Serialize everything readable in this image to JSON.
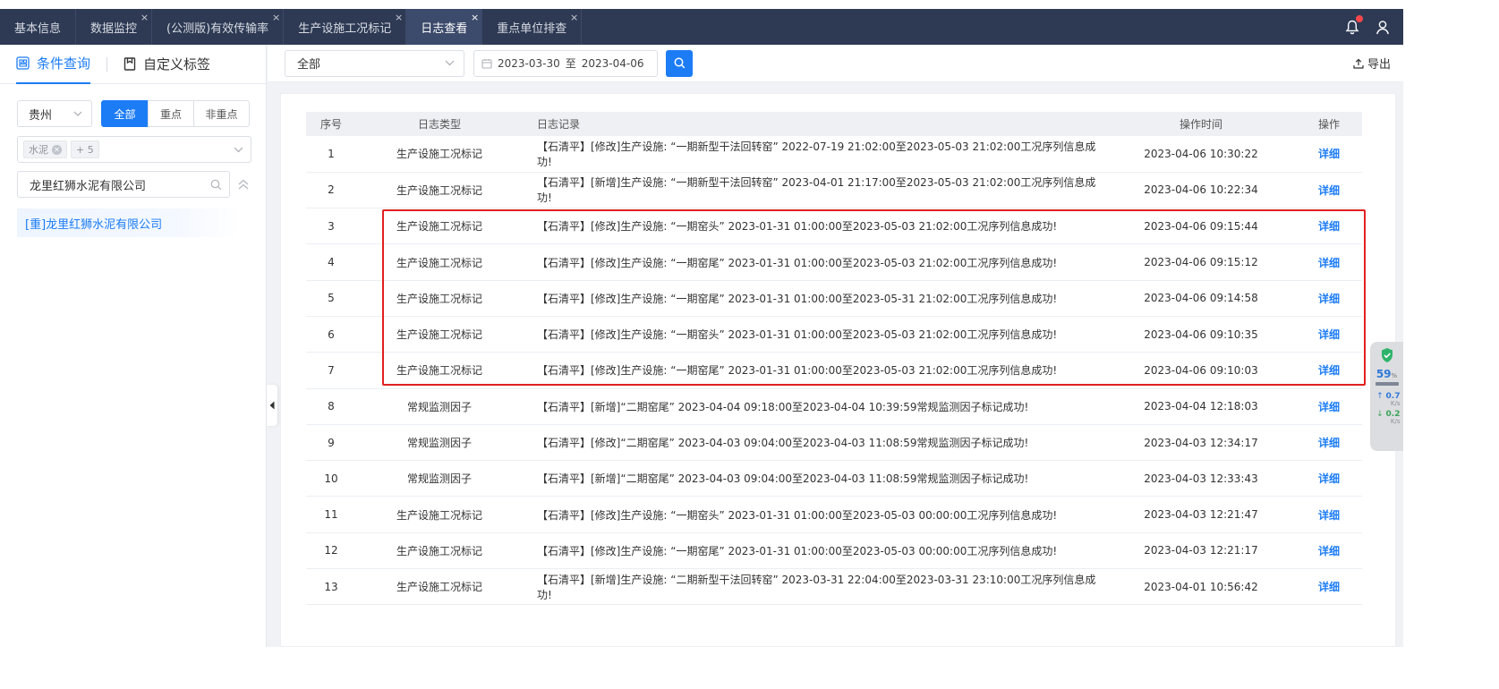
{
  "tabs": [
    {
      "label": "基本信息",
      "closable": false,
      "active": false
    },
    {
      "label": "数据监控",
      "closable": true,
      "active": false
    },
    {
      "label": "(公测版)有效传输率",
      "closable": true,
      "active": false
    },
    {
      "label": "生产设施工况标记",
      "closable": true,
      "active": false
    },
    {
      "label": "日志查看",
      "closable": true,
      "active": true
    },
    {
      "label": "重点单位排查",
      "closable": true,
      "active": false
    }
  ],
  "close_glyph": "×",
  "header_icons": [
    "bell-icon",
    "user-icon"
  ],
  "left_panel": {
    "tab_query": "条件查询",
    "tab_custom": "自定义标签",
    "region": "贵州",
    "filters": [
      "全部",
      "重点",
      "非重点"
    ],
    "industry_chip": "水泥",
    "industry_more": "+ 5",
    "search_value": "龙里红狮水泥有限公司",
    "tree_item": "[重]龙里红狮水泥有限公司"
  },
  "toolbar": {
    "log_type": "全部",
    "date_start": "2023-03-30",
    "date_sep": "至",
    "date_end": "2023-04-06",
    "export_label": "导出"
  },
  "table": {
    "headers": {
      "index": "序号",
      "type": "日志类型",
      "record": "日志记录",
      "time": "操作时间",
      "op": "操作"
    },
    "rows": [
      {
        "index": "1",
        "type": "生产设施工况标记",
        "record": "【石清平】[修改]生产设施: “一期新型干法回转窑” 2022-07-19 21:02:00至2023-05-03 21:02:00工况序列信息成功!",
        "time": "2023-04-06 10:30:22",
        "op": "详细"
      },
      {
        "index": "2",
        "type": "生产设施工况标记",
        "record": "【石清平】[新增]生产设施: “一期新型干法回转窑” 2023-04-01 21:17:00至2023-05-03 21:02:00工况序列信息成功!",
        "time": "2023-04-06 10:22:34",
        "op": "详细"
      },
      {
        "index": "3",
        "type": "生产设施工况标记",
        "record": "【石清平】[修改]生产设施: “一期窑头” 2023-01-31 01:00:00至2023-05-03 21:02:00工况序列信息成功!",
        "time": "2023-04-06 09:15:44",
        "op": "详细"
      },
      {
        "index": "4",
        "type": "生产设施工况标记",
        "record": "【石清平】[修改]生产设施: “一期窑尾” 2023-01-31 01:00:00至2023-05-03 21:02:00工况序列信息成功!",
        "time": "2023-04-06 09:15:12",
        "op": "详细"
      },
      {
        "index": "5",
        "type": "生产设施工况标记",
        "record": "【石清平】[修改]生产设施: “一期窑尾” 2023-01-31 01:00:00至2023-05-31 21:02:00工况序列信息成功!",
        "time": "2023-04-06 09:14:58",
        "op": "详细"
      },
      {
        "index": "6",
        "type": "生产设施工况标记",
        "record": "【石清平】[修改]生产设施: “一期窑头” 2023-01-31 01:00:00至2023-05-03 21:02:00工况序列信息成功!",
        "time": "2023-04-06 09:10:35",
        "op": "详细"
      },
      {
        "index": "7",
        "type": "生产设施工况标记",
        "record": "【石清平】[修改]生产设施: “一期窑尾” 2023-01-31 01:00:00至2023-05-03 21:02:00工况序列信息成功!",
        "time": "2023-04-06 09:10:03",
        "op": "详细"
      },
      {
        "index": "8",
        "type": "常规监测因子",
        "record": "【石清平】[新增]“二期窑尾” 2023-04-04 09:18:00至2023-04-04 10:39:59常规监测因子标记成功!",
        "time": "2023-04-04 12:18:03",
        "op": "详细"
      },
      {
        "index": "9",
        "type": "常规监测因子",
        "record": "【石清平】[修改]“二期窑尾” 2023-04-03 09:04:00至2023-04-03 11:08:59常规监测因子标记成功!",
        "time": "2023-04-03 12:34:17",
        "op": "详细"
      },
      {
        "index": "10",
        "type": "常规监测因子",
        "record": "【石清平】[新增]“二期窑尾” 2023-04-03 09:04:00至2023-04-03 11:08:59常规监测因子标记成功!",
        "time": "2023-04-03 12:33:43",
        "op": "详细"
      },
      {
        "index": "11",
        "type": "生产设施工况标记",
        "record": "【石清平】[修改]生产设施: “一期窑头” 2023-01-31 01:00:00至2023-05-03 00:00:00工况序列信息成功!",
        "time": "2023-04-03 12:21:47",
        "op": "详细"
      },
      {
        "index": "12",
        "type": "生产设施工况标记",
        "record": "【石清平】[修改]生产设施: “一期窑尾” 2023-01-31 01:00:00至2023-05-03 00:00:00工况序列信息成功!",
        "time": "2023-04-03 12:21:17",
        "op": "详细"
      },
      {
        "index": "13",
        "type": "生产设施工况标记",
        "record": "【石清平】[新增]生产设施: “二期新型干法回转窑” 2023-03-31 22:04:00至2023-03-31 23:10:00工况序列信息成功!",
        "time": "2023-04-01 10:56:42",
        "op": "详细"
      }
    ]
  },
  "highlight_rows": [
    3,
    7
  ],
  "widget": {
    "percent": "59",
    "percent_unit": "%",
    "up_value": "0.7",
    "up_unit": "K/s",
    "down_value": "0.2",
    "down_unit": "K/s"
  },
  "colors": {
    "accent": "#1c7cf5",
    "tabbar": "#2e3a54",
    "highlight": "#e02020",
    "badge": "#f5474b"
  }
}
